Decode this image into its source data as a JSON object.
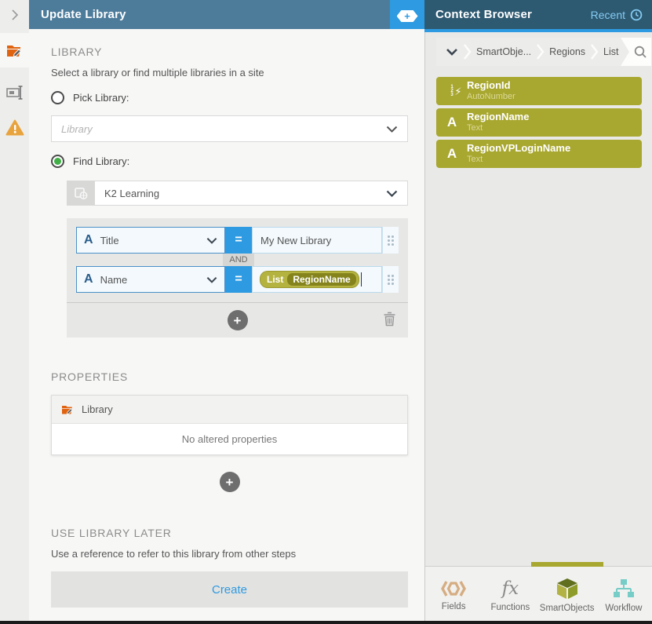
{
  "header": {
    "left_title": "Update Library",
    "right_title": "Context Browser",
    "recent_label": "Recent"
  },
  "icons": {
    "plus": "+",
    "text_a": "A",
    "fx_text": "fx"
  },
  "library_section": {
    "heading": "LIBRARY",
    "description": "Select a library or find multiple libraries in a site",
    "pick_label": "Pick Library:",
    "pick_placeholder": "Library",
    "find_label": "Find Library:",
    "site_value": "K2 Learning",
    "filters": {
      "join_label": "AND",
      "rows": [
        {
          "field": "Title",
          "operator": "=",
          "value": "My New Library"
        },
        {
          "field": "Name",
          "operator": "=",
          "token_scope": "List",
          "token_name": "RegionName"
        }
      ]
    }
  },
  "properties_section": {
    "heading": "PROPERTIES",
    "item_label": "Library",
    "empty_text": "No altered properties"
  },
  "use_later_section": {
    "heading": "USE LIBRARY LATER",
    "description": "Use a reference to refer to this library from other steps",
    "create_label": "Create"
  },
  "context_browser": {
    "breadcrumb": [
      "SmartObje...",
      "Regions",
      "List"
    ],
    "fields": [
      {
        "name": "RegionId",
        "type": "AutoNumber"
      },
      {
        "name": "RegionName",
        "type": "Text"
      },
      {
        "name": "RegionVPLoginName",
        "type": "Text"
      }
    ],
    "tabs": [
      {
        "label": "Fields"
      },
      {
        "label": "Functions"
      },
      {
        "label": "SmartObjects"
      },
      {
        "label": "Workflow"
      }
    ],
    "active_tab": "SmartObjects"
  },
  "colors": {
    "accent_blue": "#2e9ae1",
    "header_left": "#4d7c9b",
    "header_right": "#2d5971",
    "olive": "#a8a72f",
    "radio_green": "#3faf46",
    "warning_orange": "#e8a33d"
  }
}
